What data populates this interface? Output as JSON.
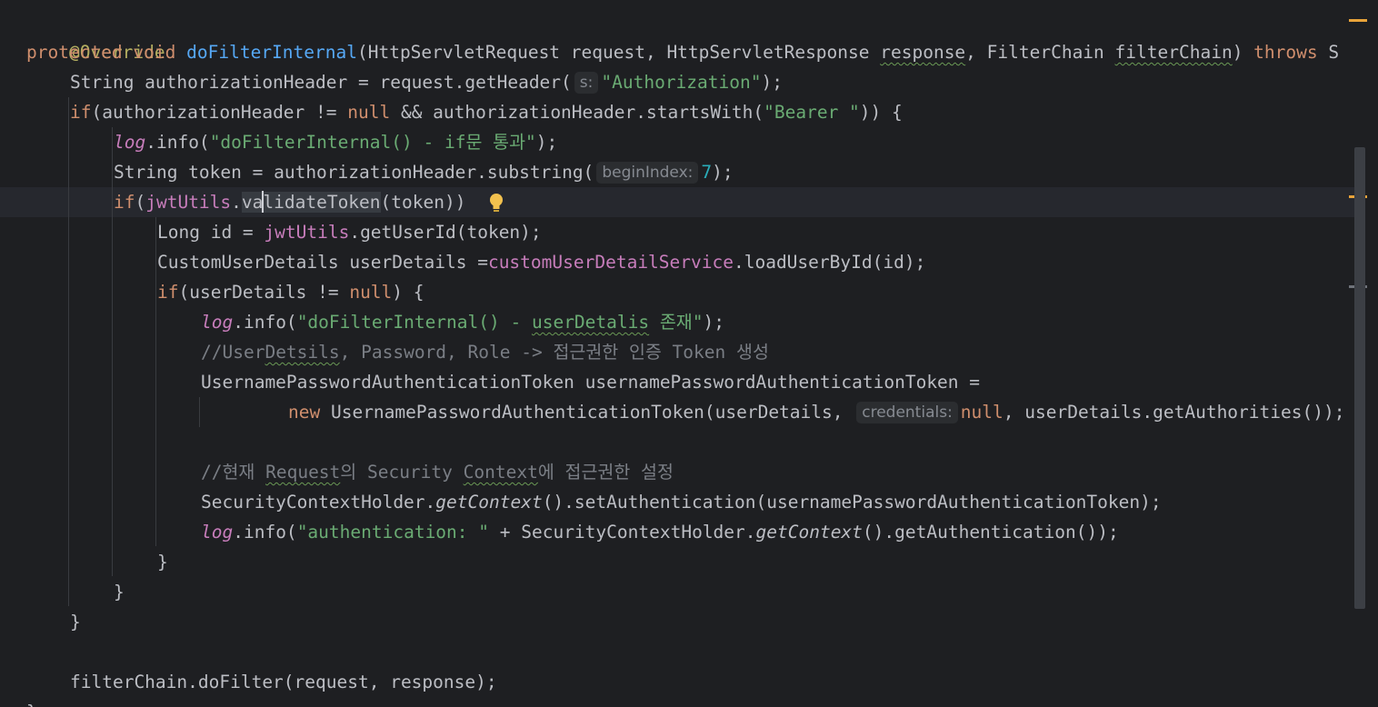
{
  "editor": {
    "theme": {
      "background": "#1e1f22",
      "keyword": "#cf8e6d",
      "method": "#56a8f5",
      "string": "#6aab73",
      "number": "#2aacb8",
      "annotation": "#b3ae60",
      "field": "#c77dbb",
      "comment": "#7a7e85",
      "warning_marker": "#e8a33a"
    },
    "hints": {
      "s": "s:",
      "begin_index": "beginIndex:",
      "credentials": "credentials:"
    },
    "code": {
      "annotation": "@Override",
      "l1_protected": "protected",
      "l1_void": "void",
      "l1_method": "doFilterInternal",
      "l1_params_a": "(HttpServletRequest request, HttpServletResponse ",
      "l1_response": "response",
      "l1_params_b": ", FilterChain ",
      "l1_filterchain": "filterChain",
      "l1_close": ") ",
      "l1_throws": "throws",
      "l1_tail": " S",
      "l2_a": "String authorizationHeader = request.getHeader(",
      "l2_str": "\"Authorization\"",
      "l2_end": ");",
      "l3_if": "if",
      "l3_a": "(authorizationHeader != ",
      "l3_null": "null",
      "l3_b": " && authorizationHeader.startsWith(",
      "l3_str": "\"Bearer \"",
      "l3_end": ")) {",
      "l4_log": "log",
      "l4_a": ".info(",
      "l4_str": "\"doFilterInternal() - if문 통과\"",
      "l4_end": ");",
      "l5_a": "String token = authorizationHeader.substring(",
      "l5_num": "7",
      "l5_end": ");",
      "l6_if": "if",
      "l6_paren": "(",
      "l6_field": "jwtUtils",
      "l6_dot": ".",
      "l6_method_a": "va",
      "l6_method_b": "lidateToken",
      "l6_end": "(token)) ",
      "l7_a": "Long id = ",
      "l7_field": "jwtUtils",
      "l7_end": ".getUserId(token);",
      "l8_a": "CustomUserDetails userDetails =",
      "l8_field": "customUserDetailService",
      "l8_end": ".loadUserById(id);",
      "l9_if": "if",
      "l9_a": "(userDetails != ",
      "l9_null": "null",
      "l9_end": ") {",
      "l10_log": "log",
      "l10_a": ".info(",
      "l10_str_a": "\"doFilterInternal() - ",
      "l10_str_typo": "userDetalis",
      "l10_str_b": " 존재\"",
      "l10_end": ");",
      "l11_a": "//User",
      "l11_typo": "Detsils",
      "l11_b": ", Password, Role -> 접근권한 인증 Token 생성",
      "l12": "UsernamePasswordAuthenticationToken usernamePasswordAuthenticationToken =",
      "l13_new": "new",
      "l13_a": " UsernamePasswordAuthenticationToken(userDetails, ",
      "l13_null": "null",
      "l13_end": ", userDetails.getAuthorities());",
      "l15_a": "//현재 ",
      "l15_typo1": "Request",
      "l15_b": "의 Security ",
      "l15_typo2": "Context",
      "l15_c": "에 접근권한 설정",
      "l16_a": "SecurityContextHolder.",
      "l16_ital": "getContext",
      "l16_end": "().setAuthentication(usernamePasswordAuthenticationToken);",
      "l17_log": "log",
      "l17_a": ".info(",
      "l17_str": "\"authentication: \"",
      "l17_b": " + SecurityContextHolder.",
      "l17_ital": "getContext",
      "l17_end": "().getAuthentication());",
      "brace_close": "}",
      "l22": "filterChain.doFilter(request, response);",
      "l23": "}"
    }
  }
}
